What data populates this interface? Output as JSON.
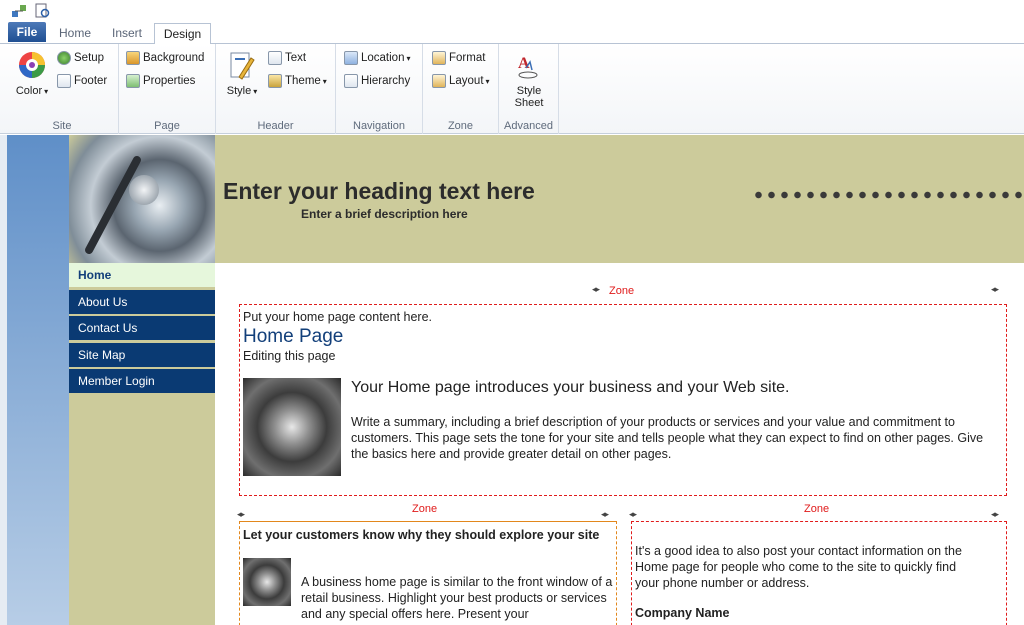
{
  "tabs": [
    "File",
    "Home",
    "Insert",
    "Design"
  ],
  "ribbon": {
    "site": {
      "label": "Site",
      "color": "Color",
      "setup": "Setup",
      "footer": "Footer"
    },
    "page": {
      "label": "Page",
      "background": "Background",
      "properties": "Properties"
    },
    "header": {
      "label": "Header",
      "style": "Style",
      "text": "Text",
      "theme": "Theme"
    },
    "navigation": {
      "label": "Navigation",
      "location": "Location",
      "hierarchy": "Hierarchy"
    },
    "zone": {
      "label": "Zone",
      "format": "Format",
      "layout": "Layout"
    },
    "advanced": {
      "label": "Advanced",
      "style_sheet_1": "Style",
      "style_sheet_2": "Sheet"
    }
  },
  "site_header": {
    "heading": "Enter your heading text here",
    "description": "Enter a brief description here"
  },
  "nav": [
    "Home",
    "About Us",
    "Contact Us",
    "Site Map",
    "Member Login"
  ],
  "zone_label": "Zone",
  "main_zone": {
    "intro": "Put your home page content here.",
    "title": "Home Page",
    "editing": "Editing this page",
    "lead": "Your Home page introduces your business and your Web site.",
    "summary": "Write a summary, including a brief description of your products or services and your value and commitment to customers. This page sets the tone for your site and tells people what they can expect to find on other pages. Give the basics here and provide greater detail on other pages."
  },
  "left_zone": {
    "heading": "Let your customers know why they should explore your site",
    "body": "A business home page is similar to the front window of a retail business. Highlight your best products or services and any special offers here. Present your"
  },
  "right_zone": {
    "body": "It's a good idea to also post your contact information on the Home page for people who come to the site to quickly find your phone number or address.",
    "company": "Company Name"
  }
}
